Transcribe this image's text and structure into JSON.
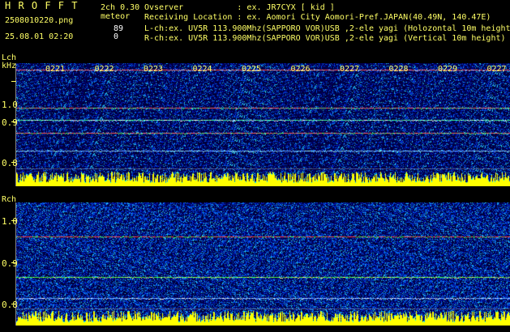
{
  "header": {
    "app_name": "H R O F F T",
    "mode": "2ch 0.30",
    "type_label": "meteor",
    "file_name": "2508010220.png",
    "date_time": "25.08.01 02:20",
    "count_l": "89",
    "count_r": "0",
    "observer": "Ovserver           : ex. JR7CYX [ kid ]",
    "location": "Receiving Location : ex. Aomori City Aomori-Pref.JAPAN(40.49N, 140.47E)",
    "lch_info": "L-ch:ex. UV5R 113.900Mhz(SAPPORO VOR)USB ,2-ele yagi (Holozontal 10m height)",
    "rch_info": "R-ch:ex. UV5R 113.900Mhz(SAPPORO VOR)USB ,2-ele yagi (Vertical 10m height)"
  },
  "lch": {
    "label": "Lch",
    "unit": "kHz",
    "yticks": [
      "1.0",
      "0.9",
      "0.8"
    ],
    "time_ticks": [
      "0221",
      "0222",
      "0223",
      "0224",
      "0225",
      "0226",
      "0227",
      "0228",
      "0229",
      "0227"
    ]
  },
  "rch": {
    "label": "Rch",
    "yticks": [
      "1.0",
      "0.9",
      "0.8"
    ]
  },
  "colors": {
    "text": "#ffff66",
    "background": "#000000",
    "noise_base": "#000080",
    "signal_bar": "#ffff00"
  }
}
